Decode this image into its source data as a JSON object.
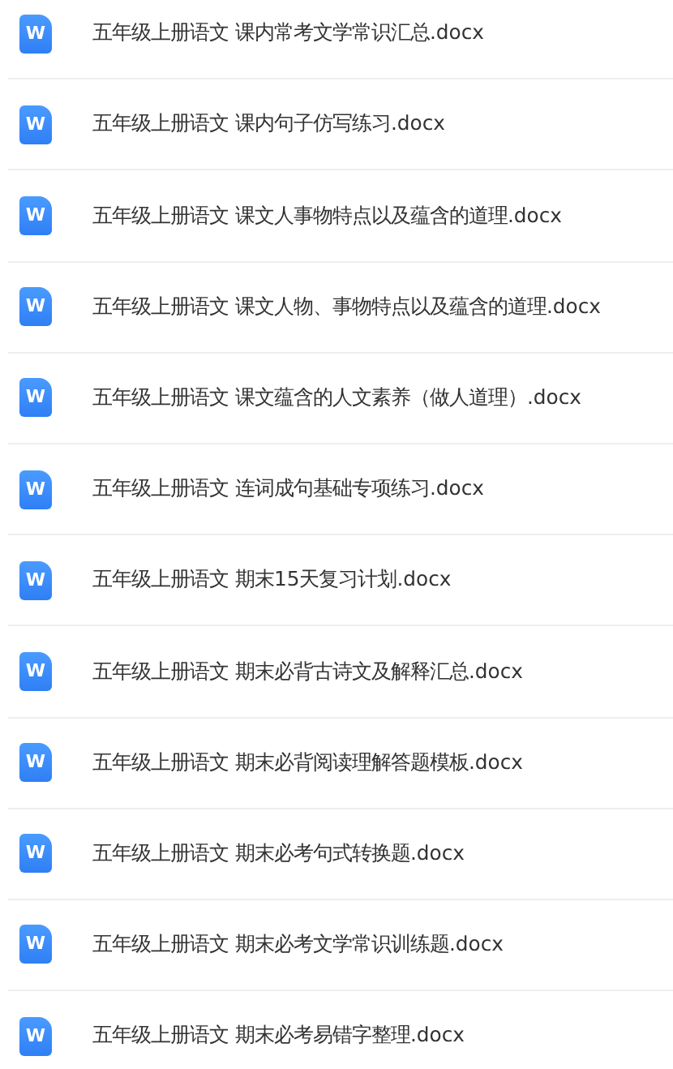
{
  "files": [
    {
      "icon_label": "W",
      "name": "五年级上册语文 课内常考文学常识汇总.docx"
    },
    {
      "icon_label": "W",
      "name": "五年级上册语文 课内句子仿写练习.docx"
    },
    {
      "icon_label": "W",
      "name": "五年级上册语文 课文人事物特点以及蕴含的道理.docx"
    },
    {
      "icon_label": "W",
      "name": "五年级上册语文 课文人物、事物特点以及蕴含的道理.docx"
    },
    {
      "icon_label": "W",
      "name": "五年级上册语文 课文蕴含的人文素养（做人道理）.docx"
    },
    {
      "icon_label": "W",
      "name": "五年级上册语文 连词成句基础专项练习.docx"
    },
    {
      "icon_label": "W",
      "name": "五年级上册语文 期末15天复习计划.docx"
    },
    {
      "icon_label": "W",
      "name": "五年级上册语文 期末必背古诗文及解释汇总.docx"
    },
    {
      "icon_label": "W",
      "name": "五年级上册语文 期末必背阅读理解答题模板.docx"
    },
    {
      "icon_label": "W",
      "name": "五年级上册语文 期末必考句式转换题.docx"
    },
    {
      "icon_label": "W",
      "name": "五年级上册语文 期末必考文学常识训练题.docx"
    },
    {
      "icon_label": "W",
      "name": "五年级上册语文 期末必考易错字整理.docx"
    }
  ]
}
